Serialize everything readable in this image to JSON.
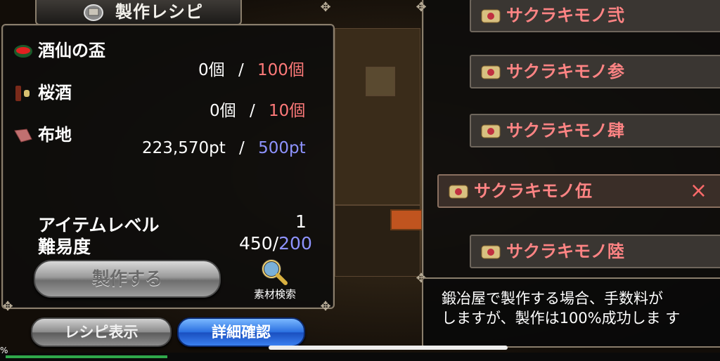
{
  "window": {
    "title": "製作レシピ"
  },
  "materials": [
    {
      "name": "酒仙の盃",
      "icon": "red-cup-icon",
      "have": "0個",
      "sep": "/",
      "need": "100個"
    },
    {
      "name": "桜酒",
      "icon": "sake-bottle-icon",
      "have": "0個",
      "sep": "/",
      "need": "10個"
    },
    {
      "name": "布地",
      "icon": "cloth-icon",
      "have": "223,570pt",
      "sep": "/",
      "need": "500pt"
    }
  ],
  "stats": {
    "item_level_label": "アイテムレベル",
    "item_level_value": "1",
    "difficulty_label": "難易度",
    "difficulty_value": "450/",
    "difficulty_max": "200"
  },
  "buttons": {
    "craft": "製作する",
    "material_search": "素材検索",
    "recipe_display": "レシピ表示",
    "detail_confirm": "詳細確認"
  },
  "recipe_list": [
    {
      "label": "サクラキモノ弐",
      "selected": false
    },
    {
      "label": "サクラキモノ参",
      "selected": false
    },
    {
      "label": "サクラキモノ肆",
      "selected": false
    },
    {
      "label": "サクラキモノ伍",
      "selected": true
    },
    {
      "label": "サクラキモノ陸",
      "selected": false
    }
  ],
  "close_mark": "×",
  "description": {
    "line1": "鍛冶屋で製作する場合、手数料が",
    "line2": "しますが、製作は100%成功しま す"
  },
  "status": {
    "percent_mark": "%",
    "progress": 0.23
  },
  "colors": {
    "need_red": "#ff7a7a",
    "need_blue": "#8e93ff",
    "list_text": "#ff8484",
    "detail_button": "#2a6fe0"
  }
}
